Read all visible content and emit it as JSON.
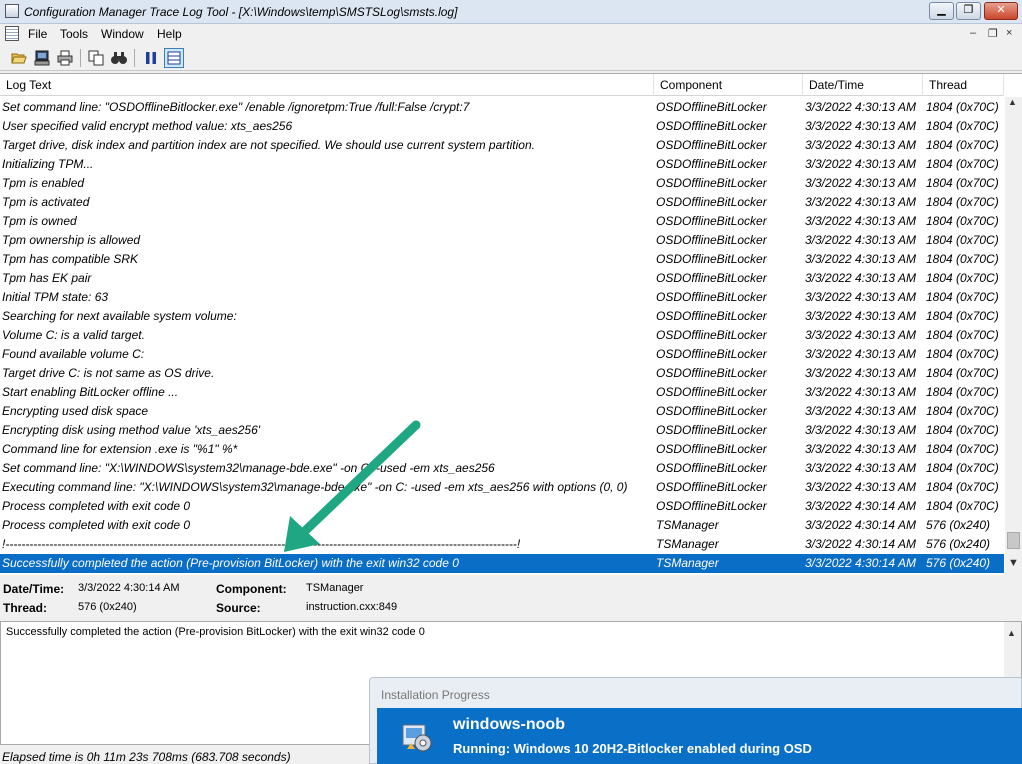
{
  "window": {
    "title": "Configuration Manager Trace Log Tool - [X:\\Windows\\temp\\SMSTSLog\\smsts.log]",
    "minimize": "▁",
    "restore": "❐",
    "close": "✕"
  },
  "menu": {
    "items": [
      "File",
      "Tools",
      "Window",
      "Help"
    ],
    "mdi_minimize": "–",
    "mdi_restore": "❐",
    "mdi_close": "×"
  },
  "toolbar": {
    "icons": [
      "open-folder-icon",
      "computer-icon",
      "printer-icon",
      "copy-icon",
      "find-icon",
      "pause-icon",
      "columns-icon"
    ]
  },
  "columns": [
    "Log Text",
    "Component",
    "Date/Time",
    "Thread"
  ],
  "rows": [
    {
      "text": "Set command line: \"OSDOfflineBitlocker.exe\" /enable /ignoretpm:True /full:False /crypt:7",
      "component": "OSDOfflineBitLocker",
      "datetime": "3/3/2022 4:30:13 AM",
      "thread": "1804 (0x70C)"
    },
    {
      "text": "User specified valid encrypt method value: xts_aes256",
      "component": "OSDOfflineBitLocker",
      "datetime": "3/3/2022 4:30:13 AM",
      "thread": "1804 (0x70C)"
    },
    {
      "text": "Target drive, disk index and partition index are not specified. We should use current system partition.",
      "component": "OSDOfflineBitLocker",
      "datetime": "3/3/2022 4:30:13 AM",
      "thread": "1804 (0x70C)"
    },
    {
      "text": "Initializing TPM...",
      "component": "OSDOfflineBitLocker",
      "datetime": "3/3/2022 4:30:13 AM",
      "thread": "1804 (0x70C)"
    },
    {
      "text": "Tpm is enabled",
      "component": "OSDOfflineBitLocker",
      "datetime": "3/3/2022 4:30:13 AM",
      "thread": "1804 (0x70C)"
    },
    {
      "text": "Tpm is activated",
      "component": "OSDOfflineBitLocker",
      "datetime": "3/3/2022 4:30:13 AM",
      "thread": "1804 (0x70C)"
    },
    {
      "text": "Tpm is owned",
      "component": "OSDOfflineBitLocker",
      "datetime": "3/3/2022 4:30:13 AM",
      "thread": "1804 (0x70C)"
    },
    {
      "text": "Tpm ownership is allowed",
      "component": "OSDOfflineBitLocker",
      "datetime": "3/3/2022 4:30:13 AM",
      "thread": "1804 (0x70C)"
    },
    {
      "text": "Tpm has compatible SRK",
      "component": "OSDOfflineBitLocker",
      "datetime": "3/3/2022 4:30:13 AM",
      "thread": "1804 (0x70C)"
    },
    {
      "text": "Tpm has EK pair",
      "component": "OSDOfflineBitLocker",
      "datetime": "3/3/2022 4:30:13 AM",
      "thread": "1804 (0x70C)"
    },
    {
      "text": "Initial TPM state: 63",
      "component": "OSDOfflineBitLocker",
      "datetime": "3/3/2022 4:30:13 AM",
      "thread": "1804 (0x70C)"
    },
    {
      "text": "Searching for next available system volume:",
      "component": "OSDOfflineBitLocker",
      "datetime": "3/3/2022 4:30:13 AM",
      "thread": "1804 (0x70C)"
    },
    {
      "text": "  Volume C: is a valid target.",
      "component": "OSDOfflineBitLocker",
      "datetime": "3/3/2022 4:30:13 AM",
      "thread": "1804 (0x70C)"
    },
    {
      "text": "Found available volume C:",
      "component": "OSDOfflineBitLocker",
      "datetime": "3/3/2022 4:30:13 AM",
      "thread": "1804 (0x70C)"
    },
    {
      "text": "Target drive C: is not same as OS drive.",
      "component": "OSDOfflineBitLocker",
      "datetime": "3/3/2022 4:30:13 AM",
      "thread": "1804 (0x70C)"
    },
    {
      "text": "Start enabling BitLocker offline ...",
      "component": "OSDOfflineBitLocker",
      "datetime": "3/3/2022 4:30:13 AM",
      "thread": "1804 (0x70C)"
    },
    {
      "text": "Encrypting used disk space",
      "component": "OSDOfflineBitLocker",
      "datetime": "3/3/2022 4:30:13 AM",
      "thread": "1804 (0x70C)"
    },
    {
      "text": "Encrypting disk using method value 'xts_aes256'",
      "component": "OSDOfflineBitLocker",
      "datetime": "3/3/2022 4:30:13 AM",
      "thread": "1804 (0x70C)"
    },
    {
      "text": "Command line for extension .exe is \"%1\" %*",
      "component": "OSDOfflineBitLocker",
      "datetime": "3/3/2022 4:30:13 AM",
      "thread": "1804 (0x70C)"
    },
    {
      "text": "Set command line: \"X:\\WINDOWS\\system32\\manage-bde.exe\" -on C: -used -em xts_aes256",
      "component": "OSDOfflineBitLocker",
      "datetime": "3/3/2022 4:30:13 AM",
      "thread": "1804 (0x70C)"
    },
    {
      "text": "Executing command line: \"X:\\WINDOWS\\system32\\manage-bde.exe\" -on C: -used -em xts_aes256 with options (0, 0)",
      "component": "OSDOfflineBitLocker",
      "datetime": "3/3/2022 4:30:13 AM",
      "thread": "1804 (0x70C)"
    },
    {
      "text": "Process completed with exit code 0",
      "component": "OSDOfflineBitLocker",
      "datetime": "3/3/2022 4:30:14 AM",
      "thread": "1804 (0x70C)"
    },
    {
      "text": "Process completed with exit code 0",
      "component": "TSManager",
      "datetime": "3/3/2022 4:30:14 AM",
      "thread": "576 (0x240)"
    },
    {
      "text": "!--------------------------------------------------------------------------------------------------------------------------------!",
      "component": "TSManager",
      "datetime": "3/3/2022 4:30:14 AM",
      "thread": "576 (0x240)"
    },
    {
      "text": "Successfully completed the action (Pre-provision BitLocker) with the exit win32 code 0",
      "component": "TSManager",
      "datetime": "3/3/2022 4:30:14 AM",
      "thread": "576 (0x240)",
      "selected": true
    }
  ],
  "details": {
    "datetime_label": "Date/Time:",
    "datetime_value": "3/3/2022 4:30:14 AM",
    "component_label": "Component:",
    "component_value": "TSManager",
    "thread_label": "Thread:",
    "thread_value": "576 (0x240)",
    "source_label": "Source:",
    "source_value": "instruction.cxx:849"
  },
  "message": "Successfully completed the action (Pre-provision BitLocker) with the exit win32 code 0",
  "status": "Elapsed time is 0h 11m 23s 708ms (683.708 seconds)",
  "progress": {
    "title": "Installation Progress",
    "name": "windows-noob",
    "status": "Running: Windows 10 20H2-Bitlocker enabled during OSD"
  },
  "colors": {
    "selection": "#0a6dc6",
    "progress_panel": "#0a6fc7",
    "annotation_arrow": "#1fa783"
  }
}
